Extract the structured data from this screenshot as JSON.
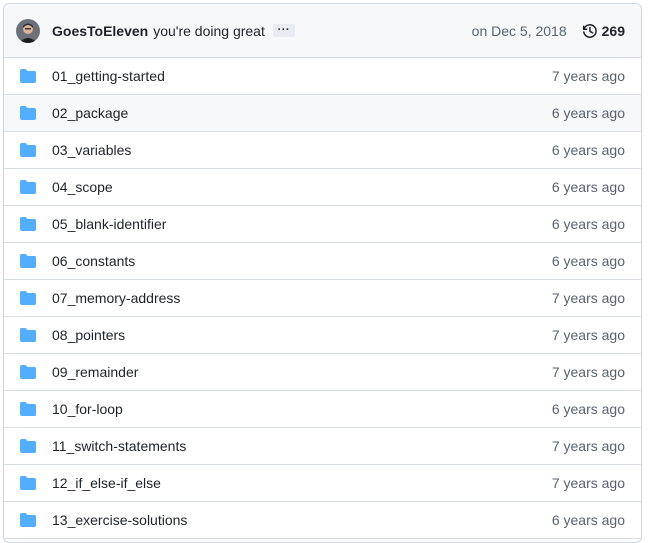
{
  "commit": {
    "author": "GoesToEleven",
    "message": "you're doing great",
    "ellipsis": "···",
    "date": "on Dec 5, 2018",
    "history_count": "269"
  },
  "colors": {
    "folder": "#54aeff",
    "muted": "#59636e",
    "border": "#d0d7de"
  },
  "icons": {
    "folder": "folder-icon",
    "history": "history-icon"
  },
  "files": [
    {
      "name": "01_getting-started",
      "age": "7 years ago"
    },
    {
      "name": "02_package",
      "age": "6 years ago"
    },
    {
      "name": "03_variables",
      "age": "6 years ago"
    },
    {
      "name": "04_scope",
      "age": "6 years ago"
    },
    {
      "name": "05_blank-identifier",
      "age": "6 years ago"
    },
    {
      "name": "06_constants",
      "age": "6 years ago"
    },
    {
      "name": "07_memory-address",
      "age": "7 years ago"
    },
    {
      "name": "08_pointers",
      "age": "7 years ago"
    },
    {
      "name": "09_remainder",
      "age": "7 years ago"
    },
    {
      "name": "10_for-loop",
      "age": "6 years ago"
    },
    {
      "name": "11_switch-statements",
      "age": "7 years ago"
    },
    {
      "name": "12_if_else-if_else",
      "age": "7 years ago"
    },
    {
      "name": "13_exercise-solutions",
      "age": "6 years ago"
    }
  ]
}
